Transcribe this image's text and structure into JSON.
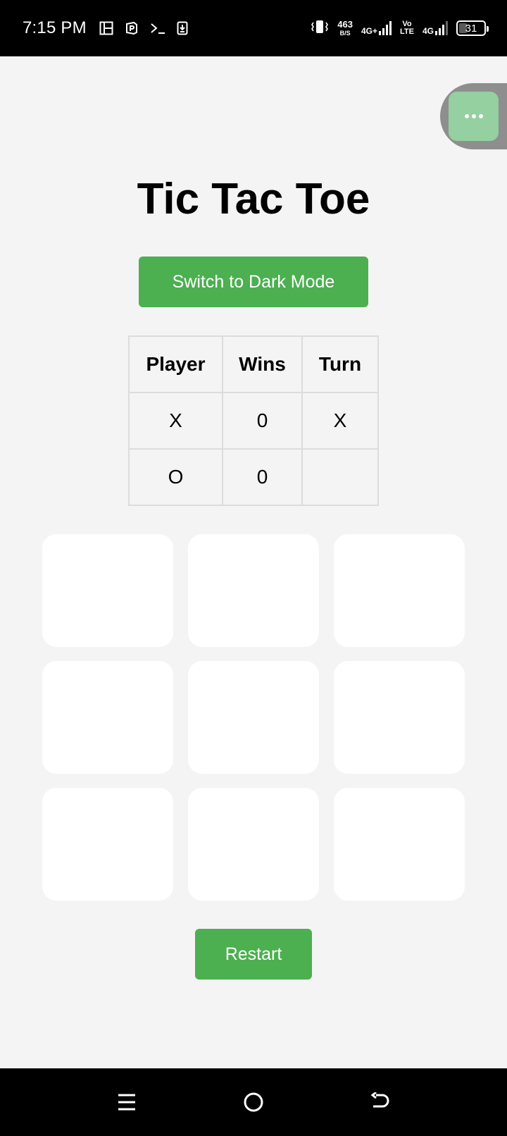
{
  "status_bar": {
    "time": "7:15 PM",
    "left_icons": [
      "gallery-icon",
      "parking-app-icon",
      "terminal-icon",
      "download-icon"
    ],
    "vibrate_icon": "vibrate-icon",
    "speed_value": "463",
    "speed_unit": "B/S",
    "network_1": "4G+",
    "volte_top": "Vo",
    "volte_bottom": "LTE",
    "network_2": "4G",
    "battery": "31",
    "battery_fraction": 0.31
  },
  "floating_bubble": {
    "icon": "more-dots-icon",
    "color": "#94d0a0"
  },
  "title": "Tic Tac Toe",
  "mode_button_label": "Switch to Dark Mode",
  "score_table": {
    "headers": [
      "Player",
      "Wins",
      "Turn"
    ],
    "rows": [
      [
        "X",
        "0",
        "X"
      ],
      [
        "O",
        "0",
        ""
      ]
    ]
  },
  "board": {
    "cells": [
      "",
      "",
      "",
      "",
      "",
      "",
      "",
      "",
      ""
    ]
  },
  "restart_label": "Restart",
  "nav_bar": {
    "icons": [
      "menu-icon",
      "home-icon",
      "back-icon"
    ]
  },
  "colors": {
    "accent": "#4caf50",
    "background": "#f4f4f4",
    "cell": "#ffffff",
    "table_border": "#dcdcdc"
  }
}
